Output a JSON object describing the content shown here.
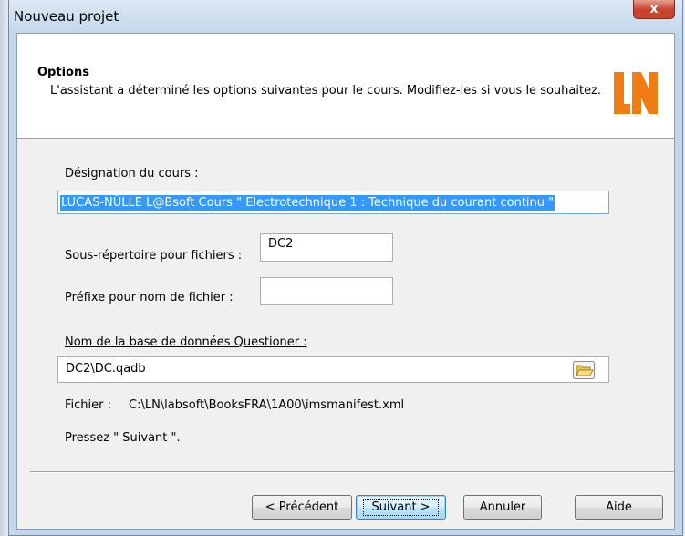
{
  "window": {
    "title": "Nouveau projet",
    "close_glyph": "x"
  },
  "header": {
    "title": "Options",
    "description": "L'assistant a déterminé les options suivantes pour le cours. Modifiez-les si vous le souhaitez.",
    "logo_text": "LN",
    "logo_color": "#f07d14"
  },
  "form": {
    "course_name_label": "Désignation du cours :",
    "course_name_value": "LUCAS-NÜLLE L@Bsoft Cours \" Electrotechnique 1 : Technique du courant continu \"",
    "subdir_label": "Sous-répertoire pour fichiers :",
    "subdir_value": "DC2",
    "prefix_label": "Préfixe pour nom de fichier :",
    "prefix_value": "",
    "db_label": "Nom de la base de données Questioner :",
    "db_value": "DC2\\DC.qadb",
    "browse_icon": "folder-open-icon",
    "file_label": "Fichier :",
    "file_path": "C:\\LN\\labsoft\\BooksFRA\\1A00\\imsmanifest.xml",
    "hint": "Pressez \" Suivant \"."
  },
  "buttons": {
    "previous": "< Précédent",
    "next": "Suivant >",
    "cancel": "Annuler",
    "help": "Aide"
  }
}
